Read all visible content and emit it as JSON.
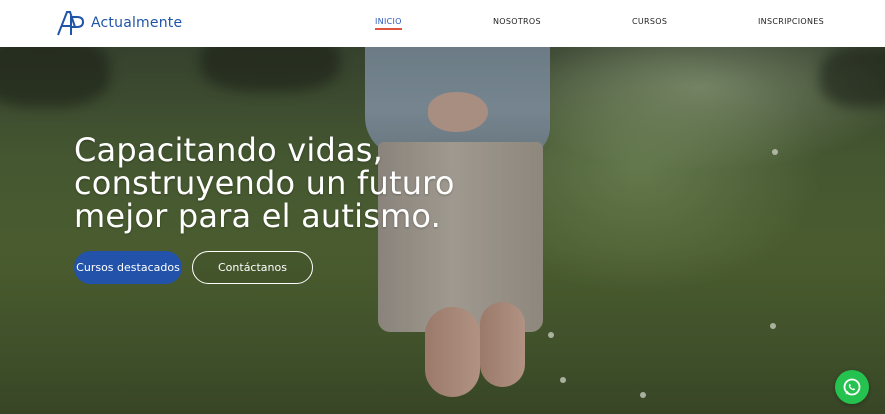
{
  "brand": {
    "name": "Actualmente",
    "icon": "logo-ap-icon",
    "color": "#1f54a8"
  },
  "nav": {
    "items": [
      {
        "label": "INICIO",
        "active": true
      },
      {
        "label": "NOSOTROS",
        "active": false
      },
      {
        "label": "CURSOS",
        "active": false
      },
      {
        "label": "INSCRIPCIONES",
        "active": false
      }
    ]
  },
  "hero": {
    "title_lines": [
      "Capacitando vidas,",
      "construyendo un futuro",
      "mejor para el autismo."
    ],
    "primary_button": "Cursos destacados",
    "secondary_button": "Contáctanos"
  },
  "floating": {
    "icon": "whatsapp-icon",
    "color": "#26c24f"
  },
  "colors": {
    "accent": "#2252a9",
    "active_underline": "#e0533f"
  }
}
